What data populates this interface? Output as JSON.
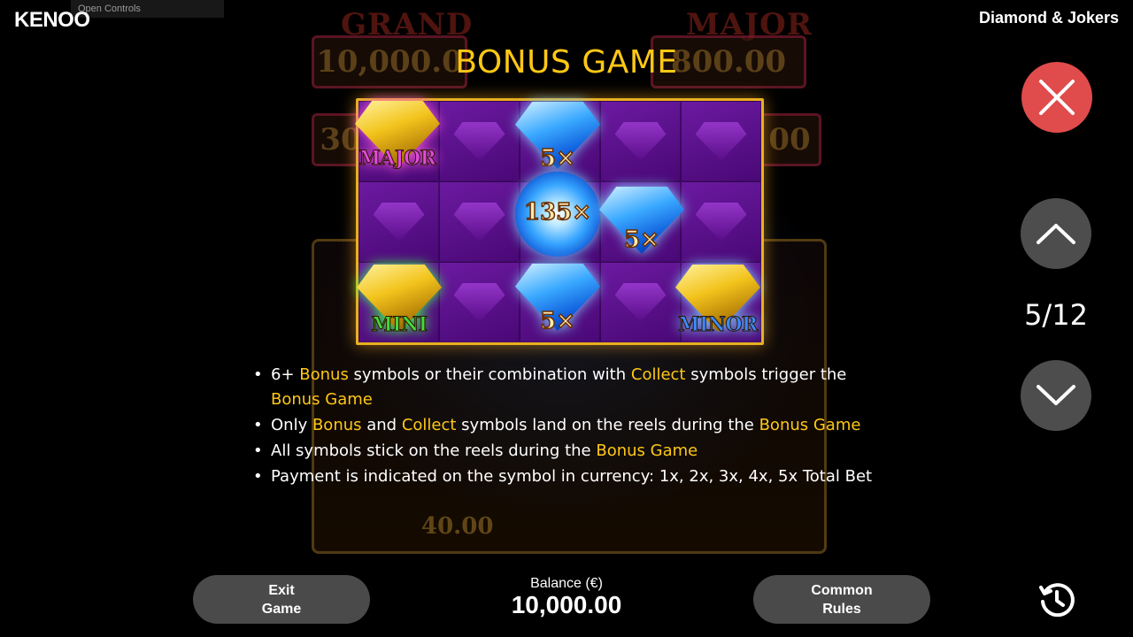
{
  "header": {
    "logo": "KENOO",
    "open_controls": "Open Controls",
    "game_name": "Diamond & Jokers"
  },
  "background": {
    "jackpots": [
      {
        "label": "GRAND",
        "amount": "10,000.0"
      },
      {
        "label": "MAJOR",
        "amount": "800.00"
      }
    ],
    "side_amounts": [
      "30",
      "00"
    ],
    "reel_amount": "40.00"
  },
  "title": "BONUS GAME",
  "grid": {
    "labels": {
      "major": "MAJOR",
      "mini": "MINI",
      "minor": "MINOR"
    },
    "multipliers": {
      "top": "5×",
      "center": "135×",
      "right": "5×",
      "bottom": "5×"
    }
  },
  "rules": [
    {
      "parts": [
        {
          "t": "6+ "
        },
        {
          "t": "Bonus",
          "h": true
        },
        {
          "t": " symbols or their combination with "
        },
        {
          "t": "Collect",
          "h": true
        },
        {
          "t": " symbols trigger the "
        },
        {
          "t": "Bonus Game",
          "h": true
        }
      ]
    },
    {
      "parts": [
        {
          "t": "Only "
        },
        {
          "t": "Bonus",
          "h": true
        },
        {
          "t": " and "
        },
        {
          "t": "Collect",
          "h": true
        },
        {
          "t": " symbols land on the reels during the "
        },
        {
          "t": "Bonus Game",
          "h": true
        }
      ]
    },
    {
      "parts": [
        {
          "t": "All symbols stick on the reels during the "
        },
        {
          "t": "Bonus Game",
          "h": true
        }
      ]
    },
    {
      "parts": [
        {
          "t": "Payment is indicated on the symbol in currency: 1x, 2x, 3x, 4x, 5x Total Bet"
        }
      ]
    }
  ],
  "controls": {
    "icons": {
      "close": "close-icon",
      "up": "chevron-up-icon",
      "down": "chevron-down-icon",
      "history": "history-icon"
    },
    "page": "5/12"
  },
  "footer": {
    "exit_line1": "Exit",
    "exit_line2": "Game",
    "balance_label": "Balance (€)",
    "balance_value": "10,000.00",
    "rules_line1": "Common",
    "rules_line2": "Rules"
  },
  "colors": {
    "highlight": "#ffc815",
    "close": "#e04b4b",
    "button": "#4d4d4d",
    "grid_border": "#e8b020"
  }
}
